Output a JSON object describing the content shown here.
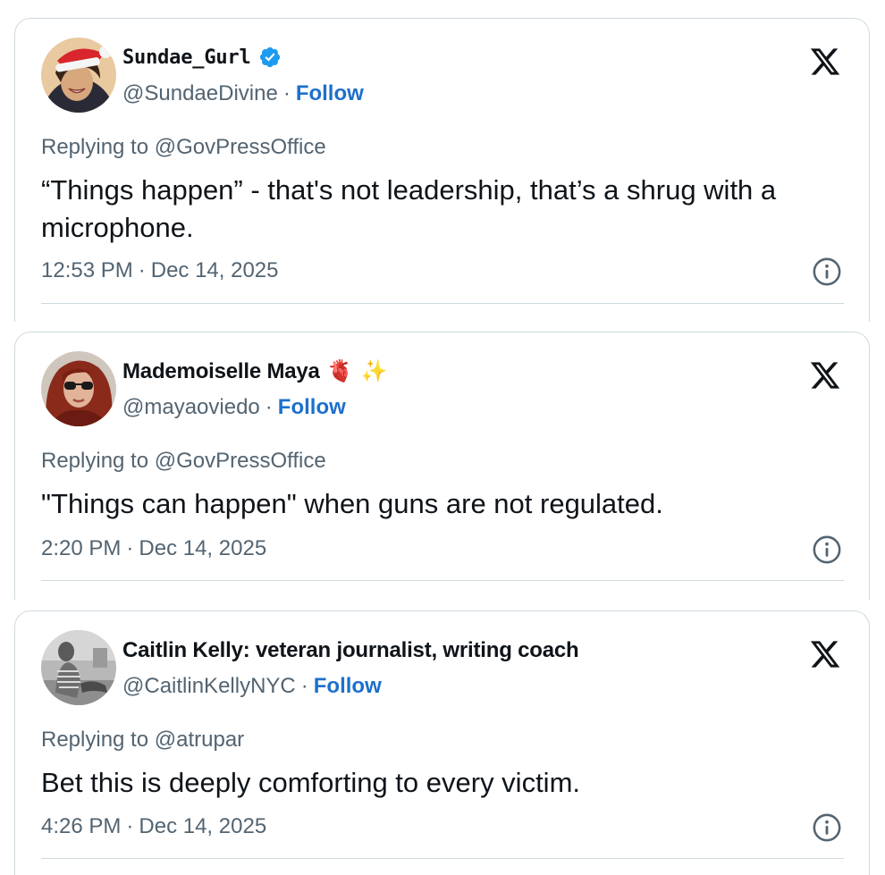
{
  "tweets": [
    {
      "display_name": "Sundae_Gurl",
      "verified": true,
      "handle": "@SundaeDivine",
      "separator": "·",
      "follow_label": "Follow",
      "replying_prefix": "Replying to ",
      "replying_to": "@GovPressOffice",
      "text": "“Things happen” - that's not leadership, that’s a shrug with a microphone.",
      "time": "12:53 PM",
      "date": "Dec 14, 2025",
      "avatar_icon": "avatar-santa-hat"
    },
    {
      "display_name": "Mademoiselle Maya",
      "name_emojis": [
        "🫀",
        "✨"
      ],
      "handle": "@mayaoviedo",
      "separator": "·",
      "follow_label": "Follow",
      "replying_prefix": "Replying to ",
      "replying_to": "@GovPressOffice",
      "text": "\"Things can happen\" when guns are not regulated.",
      "time": "2:20 PM",
      "date": "Dec 14, 2025",
      "avatar_icon": "avatar-sunglasses"
    },
    {
      "display_name": "Caitlin Kelly: veteran journalist, writing coach",
      "handle": "@CaitlinKellyNYC",
      "separator": "·",
      "follow_label": "Follow",
      "replying_prefix": "Replying to ",
      "replying_to": "@atrupar",
      "text": "Bet this is deeply comforting to every victim.",
      "time": "4:26 PM",
      "date": "Dec 14, 2025",
      "avatar_icon": "avatar-bw-photo"
    }
  ],
  "colors": {
    "link": "#1d70cc",
    "secondary_text": "#536471",
    "primary_text": "#0f1419",
    "border": "#cfd9de",
    "verified": "#1d9bf0"
  },
  "icons": {
    "platform_logo": "x-logo-icon",
    "info": "info-icon",
    "verified": "verified-badge-icon"
  }
}
